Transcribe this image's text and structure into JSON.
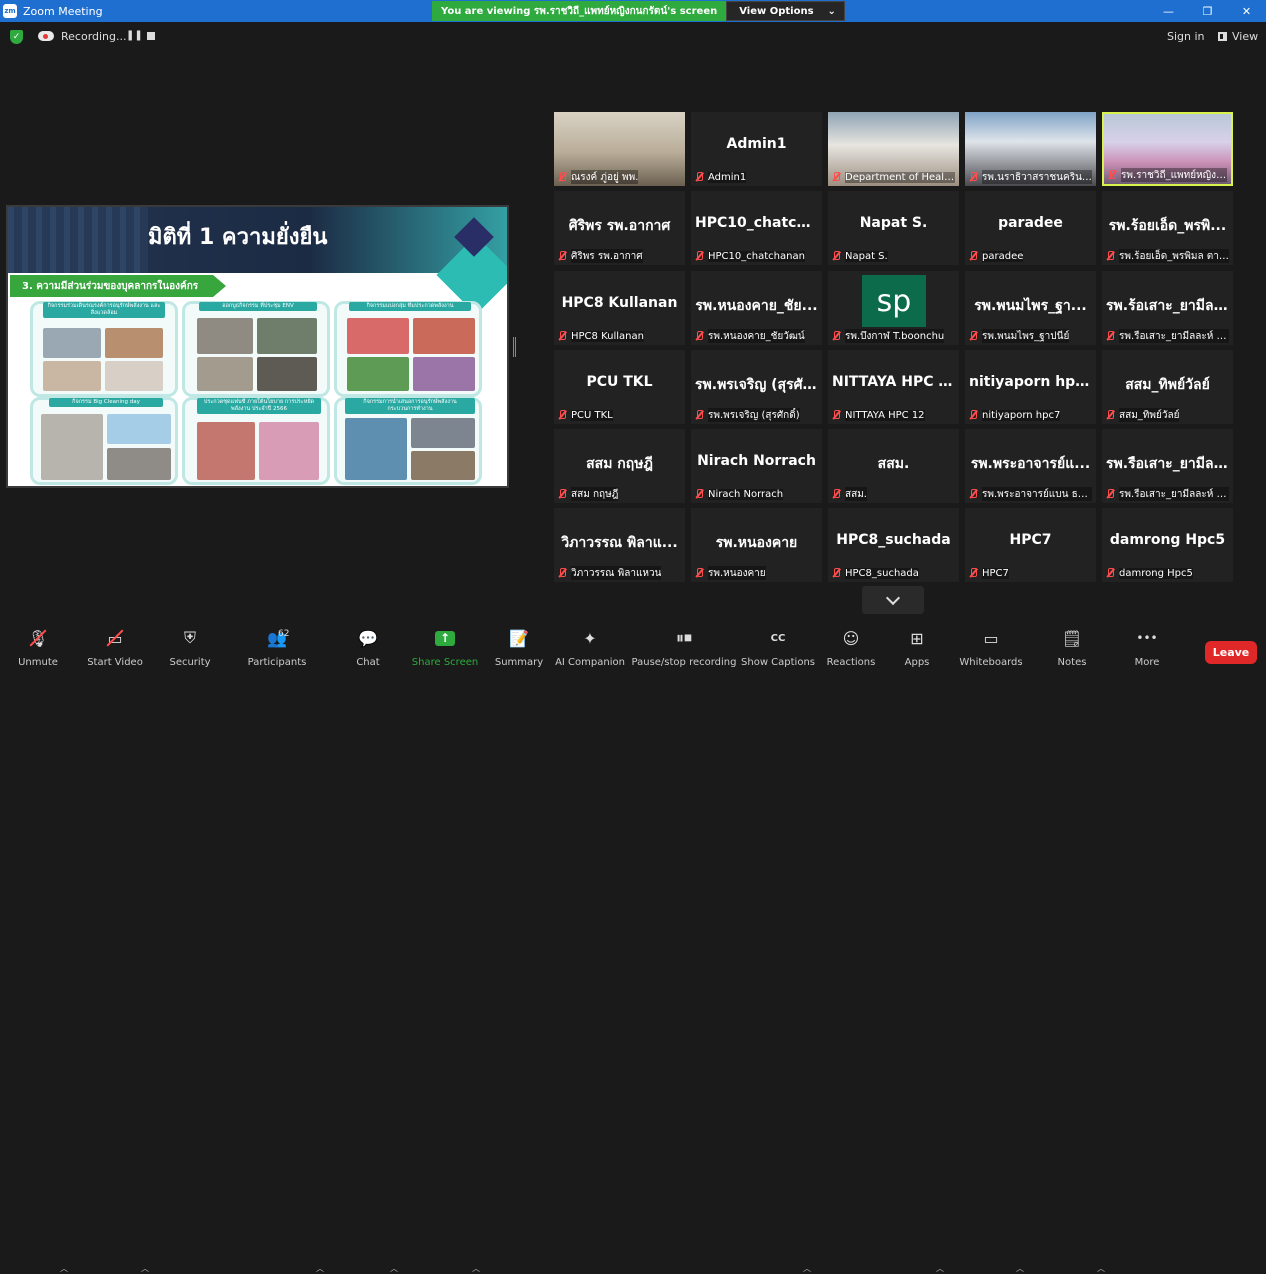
{
  "window": {
    "title": "Zoom Meeting",
    "app_icon": "zm",
    "controls": {
      "minimize": "—",
      "restore": "❐",
      "close": "✕"
    }
  },
  "share_banner": {
    "message": "You are viewing รพ.ราชวิถี_แพทย์หญิงกนกรัตน์'s screen",
    "options_label": "View Options",
    "options_caret": "⌄"
  },
  "top_strip": {
    "recording_label": "Recording...",
    "pause_glyph": "❚❚",
    "sign_in_label": "Sign in",
    "view_label": "View"
  },
  "slide": {
    "title": "มิติที่ 1 ความยั่งยืน",
    "subtitle": "3. ความมีส่วนร่วมของบุคลากรในองค์กร",
    "panels": [
      {
        "label": "กิจกรรมร่วมเดินรณรงค์การอนุรักษ์พลังงาน และสิ่งแวดล้อม"
      },
      {
        "label": "ออกบูธกิจกรรม ที่ประชุม ENV"
      },
      {
        "label": "กิจกรรมแบ่งกลุ่ม ทีมประกวดพลังงาน"
      },
      {
        "label": "กิจกรรม Big Cleaning day"
      },
      {
        "label": "ประกวดชุดแฟนซี ภายใต้นโยบาย การประหยัดพลังงาน ประจำปี 2566"
      },
      {
        "label": "กิจกรรมการนำเสนอการอนุรักษ์พลังงาน กระบวนการทำงาน"
      }
    ]
  },
  "gallery": {
    "tiles": [
      {
        "display": "",
        "name": "ณรงค์ ภู่อยู่ พพ.",
        "video": true,
        "active": false
      },
      {
        "display": "Admin1",
        "name": "Admin1",
        "video": false,
        "active": false
      },
      {
        "display": "",
        "name": "Department of Health (Th...",
        "video": true,
        "active": false
      },
      {
        "display": "",
        "name": "รพ.นราธิวาสราชนครินทร์_...",
        "video": true,
        "active": false
      },
      {
        "display": "",
        "name": "รพ.ราชวิถี_แพทย์หญิงกนกรัตน์",
        "video": true,
        "active": true
      },
      {
        "display": "ศิริพร รพ.อากาศ",
        "name": "ศิริพร รพ.อากาศ",
        "video": false,
        "active": false
      },
      {
        "display": "HPC10_chatcha...",
        "name": "HPC10_chatchanan",
        "video": false,
        "active": false
      },
      {
        "display": "Napat S.",
        "name": "Napat S.",
        "video": false,
        "active": false
      },
      {
        "display": "paradee",
        "name": "paradee",
        "video": false,
        "active": false
      },
      {
        "display": "รพ.ร้อยเอ็ด_พรพิ...",
        "name": "รพ.ร้อยเอ็ด_พรพิมล ตาลพ...",
        "video": false,
        "active": false
      },
      {
        "display": "HPC8 Kullanan",
        "name": "HPC8 Kullanan",
        "video": false,
        "active": false
      },
      {
        "display": "รพ.หนองคาย_ชัย...",
        "name": "รพ.หนองคาย_ชัยวัฒน์",
        "video": false,
        "active": false
      },
      {
        "display": "sp",
        "name": "รพ.บึงกาฬ T.boonchu",
        "video": false,
        "active": false,
        "avatar": true
      },
      {
        "display": "รพ.พนมไพร_ฐา...",
        "name": "รพ.พนมไพร_ฐาปนีย์",
        "video": false,
        "active": false
      },
      {
        "display": "รพ.ร้อเสาะ_ยามีล...",
        "name": "รพ.รือเสาะ_ยามีลละห์ เมาะมู...",
        "video": false,
        "active": false
      },
      {
        "display": "PCU TKL",
        "name": "PCU TKL",
        "video": false,
        "active": false
      },
      {
        "display": "รพ.พรเจริญ (สุรศั...",
        "name": "รพ.พรเจริญ (สุรศักดิ์)",
        "video": false,
        "active": false
      },
      {
        "display": "NITTAYA HPC 12",
        "name": "NITTAYA HPC 12",
        "video": false,
        "active": false
      },
      {
        "display": "nitiyaporn hpc7",
        "name": "nitiyaporn hpc7",
        "video": false,
        "active": false
      },
      {
        "display": "สสม_ทิพย์วัลย์",
        "name": "สสม_ทิพย์วัลย์",
        "video": false,
        "active": false
      },
      {
        "display": "สสม กฤษฎี",
        "name": "สสม กฤษฎี",
        "video": false,
        "active": false
      },
      {
        "display": "Nirach Norrach",
        "name": "Nirach Norrach",
        "video": false,
        "active": false
      },
      {
        "display": "สสม.",
        "name": "สสม.",
        "video": false,
        "active": false
      },
      {
        "display": "รพ.พระอาจารย์แ...",
        "name": "รพ.พระอาจารย์แบน ธนากโร",
        "video": false,
        "active": false
      },
      {
        "display": "รพ.รือเสาะ_ยามีล...",
        "name": "รพ.รือเสาะ_ยามีลละห์ เมาะมู...",
        "video": false,
        "active": false
      },
      {
        "display": "วิภาวรรณ พิลาแ...",
        "name": "วิภาวรรณ พิลาแหวน",
        "video": false,
        "active": false
      },
      {
        "display": "รพ.หนองคาย",
        "name": "รพ.หนองคาย",
        "video": false,
        "active": false
      },
      {
        "display": "HPC8_suchada",
        "name": "HPC8_suchada",
        "video": false,
        "active": false
      },
      {
        "display": "HPC7",
        "name": "HPC7",
        "video": false,
        "active": false
      },
      {
        "display": "damrong   Hpc5",
        "name": "damrong  Hpc5",
        "video": false,
        "active": false
      }
    ]
  },
  "toolbar": {
    "items": [
      {
        "id": "unmute",
        "label": "Unmute",
        "icon": "microphone-muted-icon"
      },
      {
        "id": "start-video",
        "label": "Start Video",
        "icon": "video-off-icon"
      },
      {
        "id": "security",
        "label": "Security",
        "icon": "shield-icon"
      },
      {
        "id": "participants",
        "label": "Participants",
        "icon": "participants-icon",
        "badge": "62"
      },
      {
        "id": "chat",
        "label": "Chat",
        "icon": "chat-icon"
      },
      {
        "id": "share-screen",
        "label": "Share Screen",
        "icon": "share-screen-icon"
      },
      {
        "id": "summary",
        "label": "Summary",
        "icon": "summary-icon"
      },
      {
        "id": "ai-companion",
        "label": "AI Companion",
        "icon": "sparkle-icon"
      },
      {
        "id": "pause-recording",
        "label": "Pause/stop recording",
        "icon": "pause-stop-icon"
      },
      {
        "id": "show-captions",
        "label": "Show Captions",
        "icon": "cc-icon",
        "glyph": "CC"
      },
      {
        "id": "reactions",
        "label": "Reactions",
        "icon": "smile-icon"
      },
      {
        "id": "apps",
        "label": "Apps",
        "icon": "apps-icon"
      },
      {
        "id": "whiteboards",
        "label": "Whiteboards",
        "icon": "whiteboard-icon"
      },
      {
        "id": "notes",
        "label": "Notes",
        "icon": "notes-icon"
      },
      {
        "id": "more",
        "label": "More",
        "icon": "more-icon",
        "glyph": "•••"
      }
    ],
    "leave_label": "Leave"
  },
  "colors": {
    "titlebar": "#1f6fd1",
    "banner_green": "#2eaa3f",
    "leave_red": "#e02828",
    "active_speaker": "#d9f24c",
    "muted_red": "#ff4d4d"
  }
}
